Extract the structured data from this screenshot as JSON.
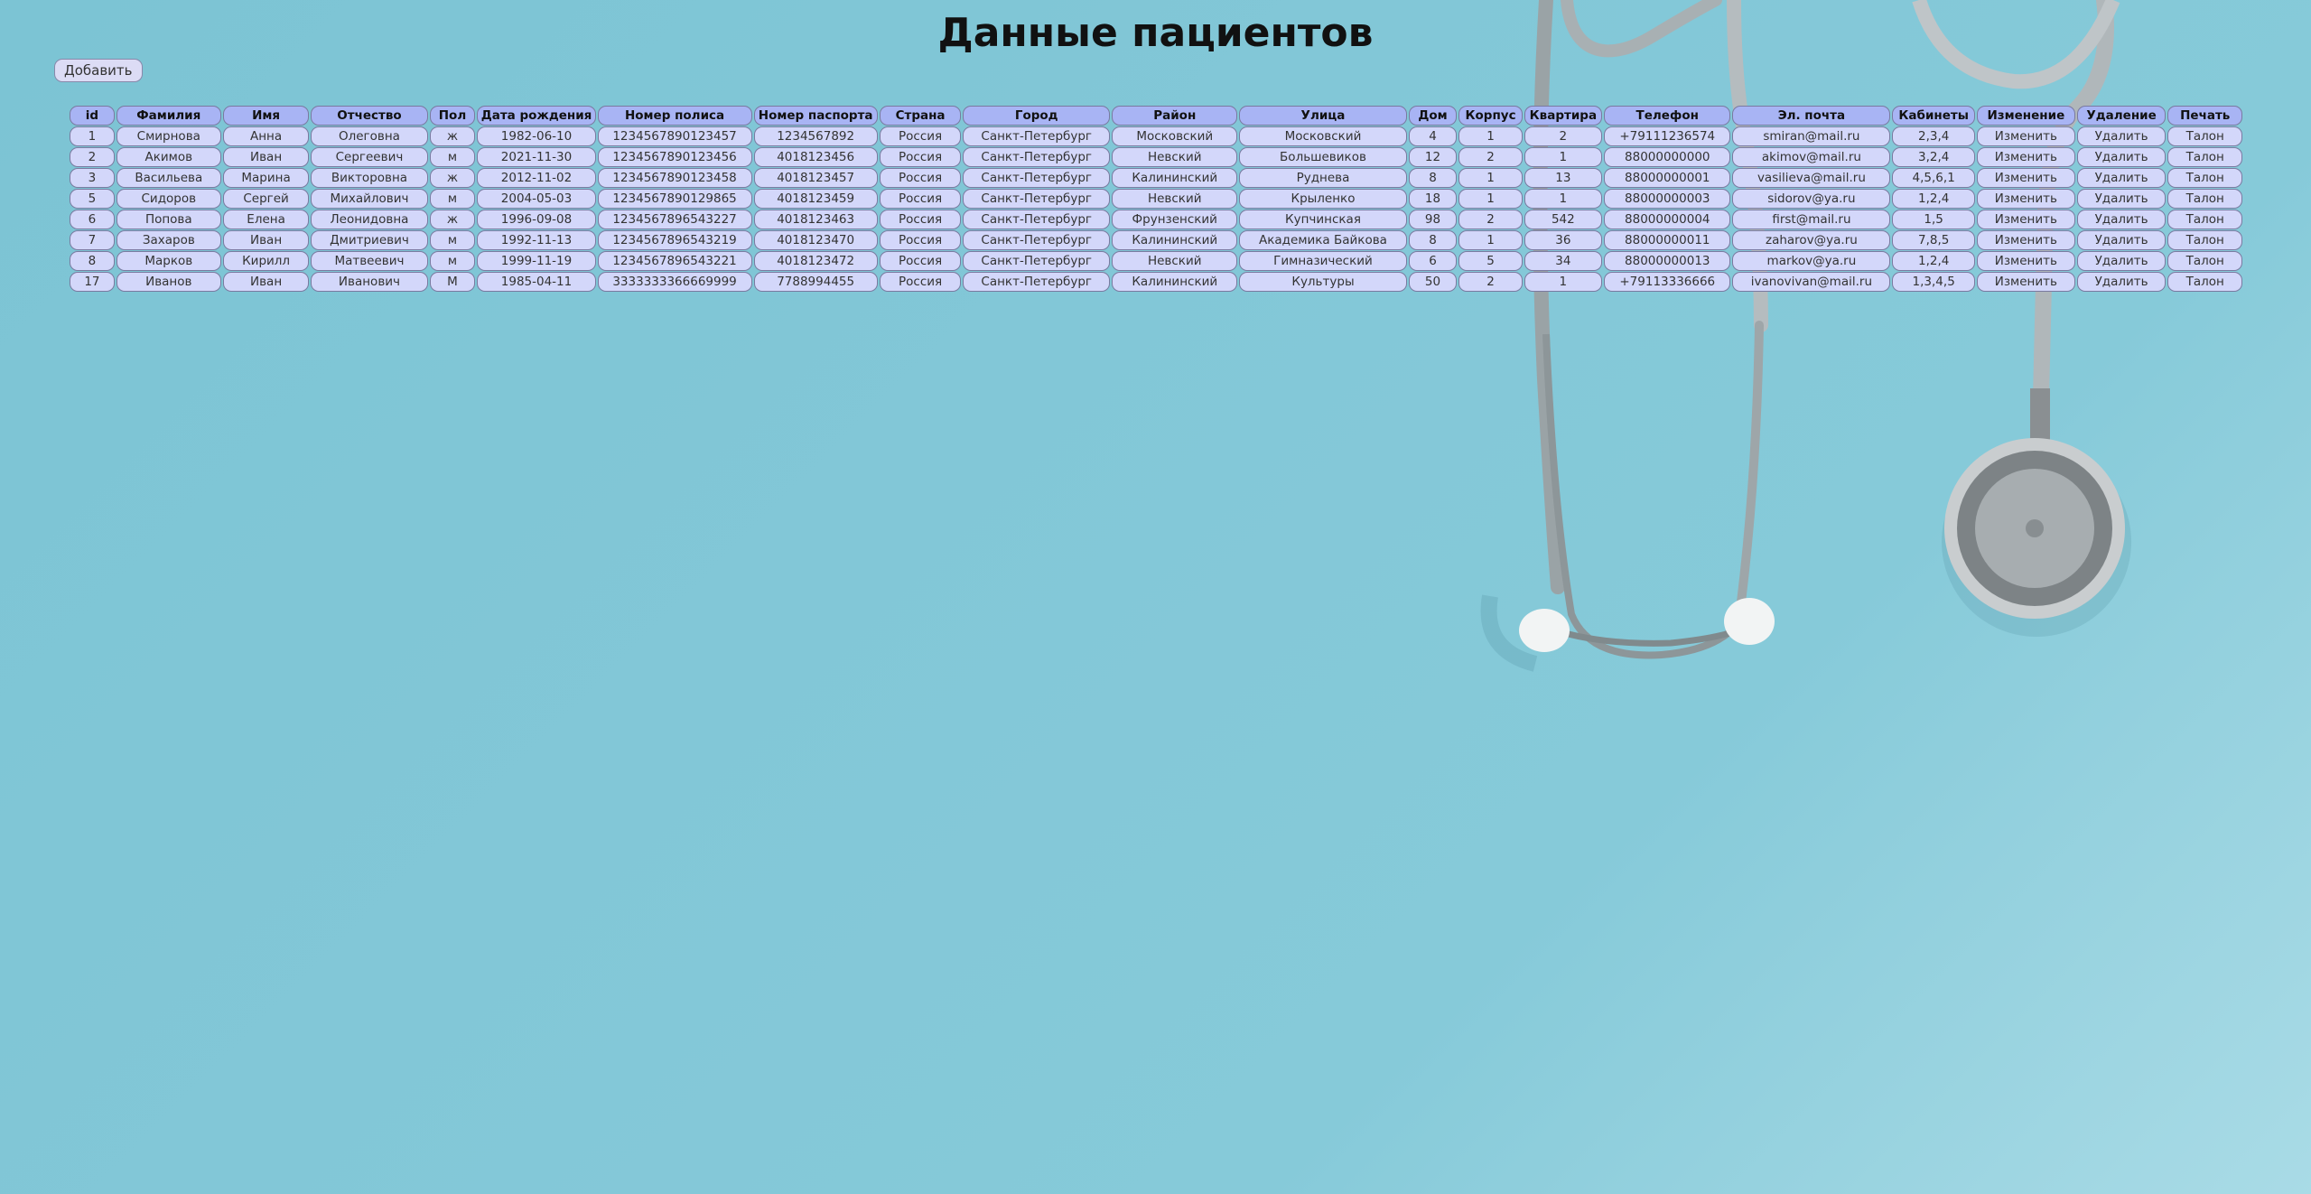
{
  "page_title": "Данные пациентов",
  "add_button": "Добавить",
  "colors": {
    "background": "#82c7d7",
    "header_cell": "#a8b4f4",
    "body_cell": "#d3d7fa",
    "cell_border": "#7a7aa0"
  },
  "table": {
    "columns": [
      "id",
      "Фамилия",
      "Имя",
      "Отчество",
      "Пол",
      "Дата рождения",
      "Номер полиса",
      "Номер паспорта",
      "Страна",
      "Город",
      "Район",
      "Улица",
      "Дом",
      "Корпус",
      "Квартира",
      "Телефон",
      "Эл. почта",
      "Кабинеты",
      "Изменение",
      "Удаление",
      "Печать"
    ],
    "rows": [
      [
        "1",
        "Смирнова",
        "Анна",
        "Олеговна",
        "ж",
        "1982-06-10",
        "1234567890123457",
        "1234567892",
        "Россия",
        "Санкт-Петербург",
        "Московский",
        "Московский",
        "4",
        "1",
        "2",
        "+79111236574",
        "smiran@mail.ru",
        "2,3,4",
        "Изменить",
        "Удалить",
        "Талон"
      ],
      [
        "2",
        "Акимов",
        "Иван",
        "Сергеевич",
        "м",
        "2021-11-30",
        "1234567890123456",
        "4018123456",
        "Россия",
        "Санкт-Петербург",
        "Невский",
        "Большевиков",
        "12",
        "2",
        "1",
        "88000000000",
        "akimov@mail.ru",
        "3,2,4",
        "Изменить",
        "Удалить",
        "Талон"
      ],
      [
        "3",
        "Васильева",
        "Марина",
        "Викторовна",
        "ж",
        "2012-11-02",
        "1234567890123458",
        "4018123457",
        "Россия",
        "Санкт-Петербург",
        "Калининский",
        "Руднева",
        "8",
        "1",
        "13",
        "88000000001",
        "vasilieva@mail.ru",
        "4,5,6,1",
        "Изменить",
        "Удалить",
        "Талон"
      ],
      [
        "5",
        "Сидоров",
        "Сергей",
        "Михайлович",
        "м",
        "2004-05-03",
        "1234567890129865",
        "4018123459",
        "Россия",
        "Санкт-Петербург",
        "Невский",
        "Крыленко",
        "18",
        "1",
        "1",
        "88000000003",
        "sidorov@ya.ru",
        "1,2,4",
        "Изменить",
        "Удалить",
        "Талон"
      ],
      [
        "6",
        "Попова",
        "Елена",
        "Леонидовна",
        "ж",
        "1996-09-08",
        "1234567896543227",
        "4018123463",
        "Россия",
        "Санкт-Петербург",
        "Фрунзенский",
        "Купчинская",
        "98",
        "2",
        "542",
        "88000000004",
        "first@mail.ru",
        "1,5",
        "Изменить",
        "Удалить",
        "Талон"
      ],
      [
        "7",
        "Захаров",
        "Иван",
        "Дмитриевич",
        "м",
        "1992-11-13",
        "1234567896543219",
        "4018123470",
        "Россия",
        "Санкт-Петербург",
        "Калининский",
        "Академика Байкова",
        "8",
        "1",
        "36",
        "88000000011",
        "zaharov@ya.ru",
        "7,8,5",
        "Изменить",
        "Удалить",
        "Талон"
      ],
      [
        "8",
        "Марков",
        "Кирилл",
        "Матвеевич",
        "м",
        "1999-11-19",
        "1234567896543221",
        "4018123472",
        "Россия",
        "Санкт-Петербург",
        "Невский",
        "Гимназический",
        "6",
        "5",
        "34",
        "88000000013",
        "markov@ya.ru",
        "1,2,4",
        "Изменить",
        "Удалить",
        "Талон"
      ],
      [
        "17",
        "Иванов",
        "Иван",
        "Иванович",
        "М",
        "1985-04-11",
        "3333333366669999",
        "7788994455",
        "Россия",
        "Санкт-Петербург",
        "Калининский",
        "Культуры",
        "50",
        "2",
        "1",
        "+79113336666",
        "ivanovivan@mail.ru",
        "1,3,4,5",
        "Изменить",
        "Удалить",
        "Талон"
      ]
    ]
  }
}
